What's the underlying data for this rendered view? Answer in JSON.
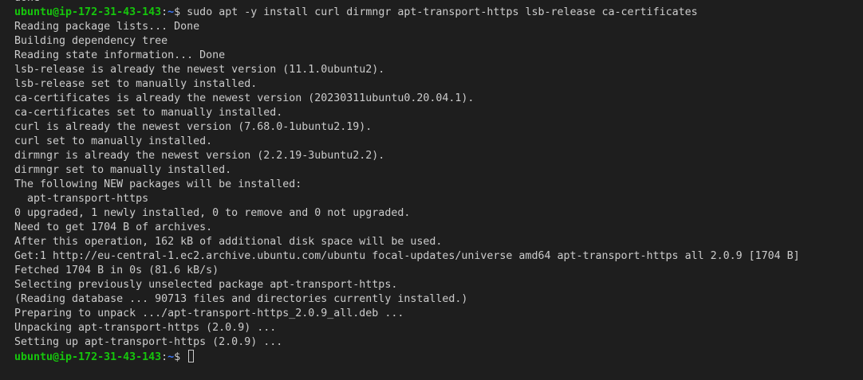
{
  "terminal": {
    "prompt": {
      "user_host": "ubuntu@ip-172-31-43-143",
      "separator": ":",
      "path": "~",
      "symbol": "$ "
    },
    "top_partial_line": "done",
    "command": "sudo apt -y install curl dirmngr apt-transport-https lsb-release ca-certificates",
    "output": [
      "Reading package lists... Done",
      "Building dependency tree",
      "Reading state information... Done",
      "lsb-release is already the newest version (11.1.0ubuntu2).",
      "lsb-release set to manually installed.",
      "ca-certificates is already the newest version (20230311ubuntu0.20.04.1).",
      "ca-certificates set to manually installed.",
      "curl is already the newest version (7.68.0-1ubuntu2.19).",
      "curl set to manually installed.",
      "dirmngr is already the newest version (2.2.19-3ubuntu2.2).",
      "dirmngr set to manually installed.",
      "The following NEW packages will be installed:",
      "  apt-transport-https",
      "0 upgraded, 1 newly installed, 0 to remove and 0 not upgraded.",
      "Need to get 1704 B of archives.",
      "After this operation, 162 kB of additional disk space will be used.",
      "Get:1 http://eu-central-1.ec2.archive.ubuntu.com/ubuntu focal-updates/universe amd64 apt-transport-https all 2.0.9 [1704 B]",
      "Fetched 1704 B in 0s (81.6 kB/s)",
      "Selecting previously unselected package apt-transport-https.",
      "(Reading database ... 90713 files and directories currently installed.)",
      "Preparing to unpack .../apt-transport-https_2.0.9_all.deb ...",
      "Unpacking apt-transport-https (2.0.9) ...",
      "Setting up apt-transport-https (2.0.9) ..."
    ],
    "colors": {
      "background": "#1e1e1e",
      "foreground": "#cccccc",
      "user_host": "#16c60c",
      "path": "#3b78ff"
    }
  }
}
